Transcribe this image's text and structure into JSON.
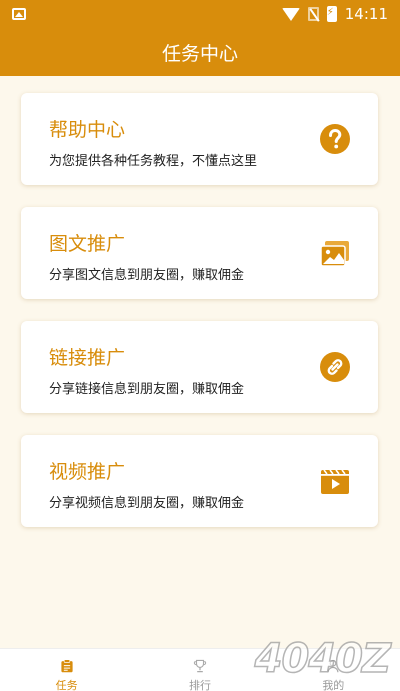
{
  "status_bar": {
    "time": "14:11",
    "icons": [
      "image-icon",
      "wifi-icon",
      "no-sim-icon",
      "battery-charging-icon"
    ]
  },
  "header": {
    "title": "任务中心"
  },
  "cards": [
    {
      "title": "帮助中心",
      "desc": "为您提供各种任务教程，不懂点这里",
      "icon": "help-icon"
    },
    {
      "title": "图文推广",
      "desc": "分享图文信息到朋友圈，赚取佣金",
      "icon": "image-gallery-icon"
    },
    {
      "title": "链接推广",
      "desc": "分享链接信息到朋友圈，赚取佣金",
      "icon": "link-icon"
    },
    {
      "title": "视频推广",
      "desc": "分享视频信息到朋友圈，赚取佣金",
      "icon": "video-icon"
    }
  ],
  "bottom_tabs": [
    {
      "label": "任务",
      "icon": "task-clipboard-icon",
      "active": true
    },
    {
      "label": "排行",
      "icon": "trophy-icon",
      "active": false
    },
    {
      "label": "我的",
      "icon": "user-icon",
      "active": false
    }
  ],
  "watermark": "4040Z",
  "colors": {
    "accent": "#d88d0c",
    "background": "#fdf8ec"
  }
}
